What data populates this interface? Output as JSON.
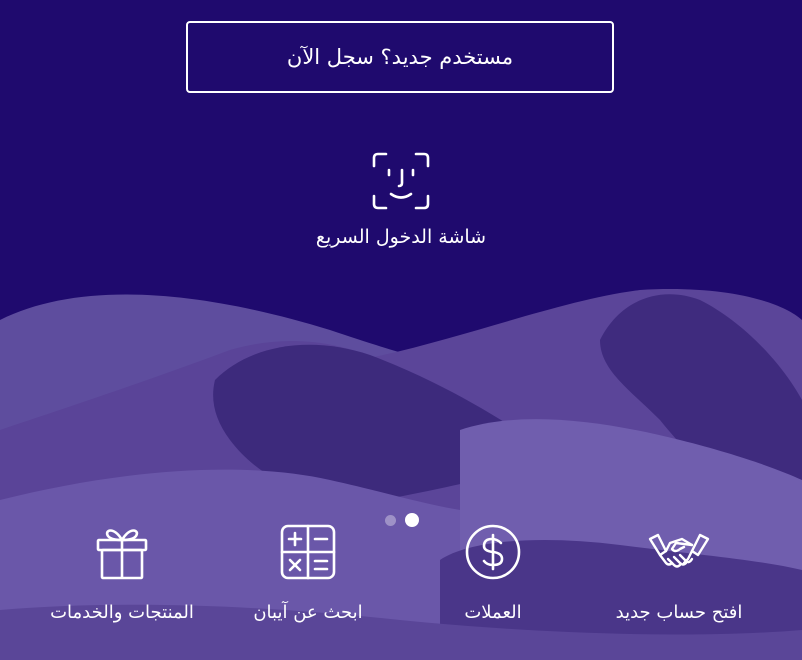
{
  "header": {
    "register_label": "مستخدم جديد؟ سجل الآن"
  },
  "quick_login": {
    "label": "شاشة الدخول السريع",
    "icon": "face-id-icon"
  },
  "pager": {
    "count": 2,
    "active_index": 1
  },
  "shortcuts": [
    {
      "label": "المنتجات والخدمات",
      "icon": "gift-icon"
    },
    {
      "label": "ابحث عن آيبان",
      "icon": "calculator-icon"
    },
    {
      "label": "العملات",
      "icon": "dollar-icon"
    },
    {
      "label": "افتح حساب جديد",
      "icon": "handshake-icon"
    }
  ],
  "colors": {
    "background": "#1f0a6e",
    "dune_light": "#6a56a8",
    "dune_mid": "#5a449a",
    "dune_dark": "#3e2a7d"
  }
}
